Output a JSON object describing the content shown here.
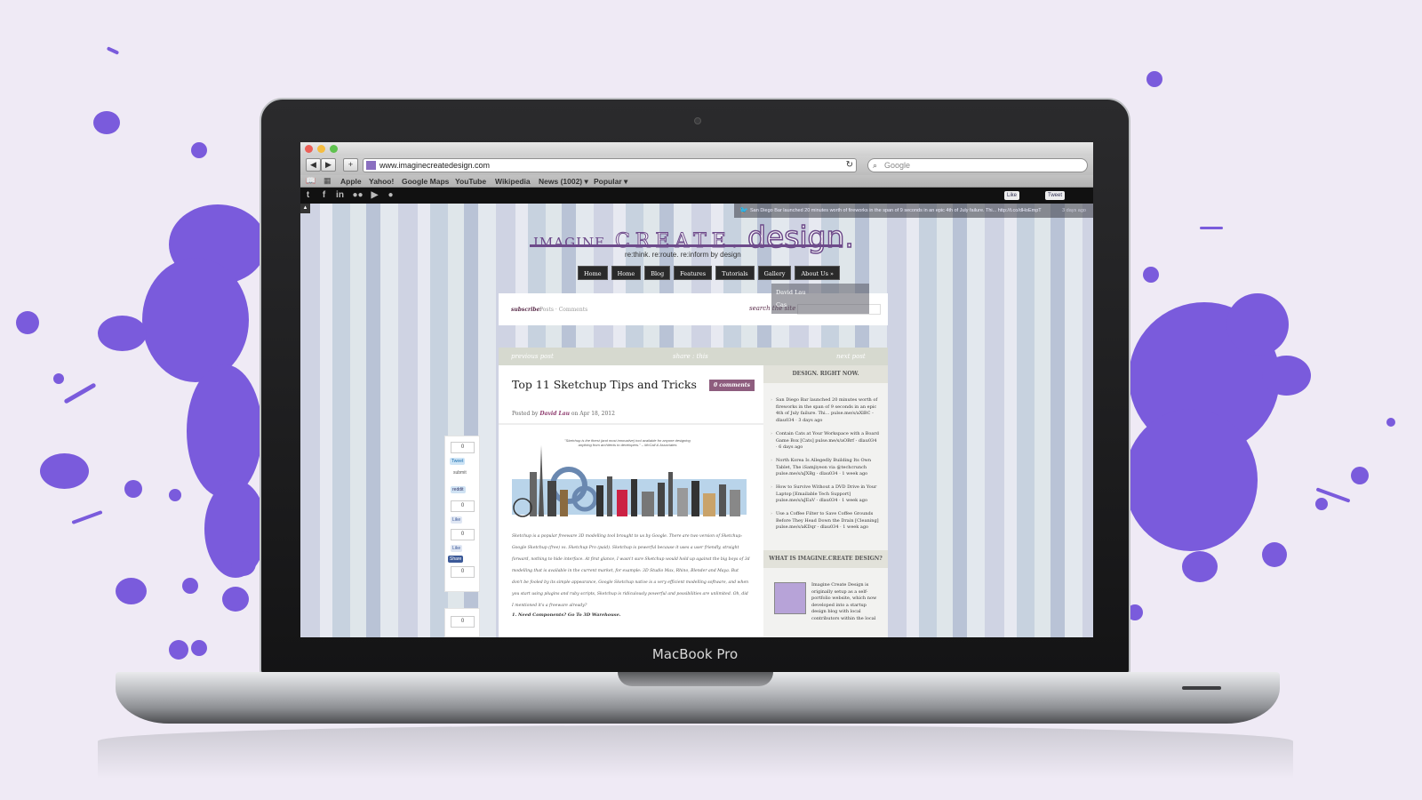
{
  "device": {
    "label": "MacBook Pro"
  },
  "browser": {
    "url": "www.imaginecreatedesign.com",
    "search_placeholder": "Google",
    "bookmarks": [
      "Apple",
      "Yahoo!",
      "Google Maps",
      "YouTube",
      "Wikipedia",
      "News (1002) ▾",
      "Popular ▾"
    ]
  },
  "social_bar": {
    "icons": [
      "twitter-icon",
      "facebook-icon",
      "linkedin-icon",
      "flickr-icon",
      "youtube-icon",
      "apple-icon"
    ],
    "like_label": "Like",
    "tweet_label": "Tweet"
  },
  "ticker": {
    "text": "San Diego Bar launched 20 minutes worth of fireworks in the span of 9 seconds in an epic 4th of July failure. Thi... http://t.co/dHoEmpT",
    "ago": "3 days ago"
  },
  "site": {
    "logo_imagine": "IMAGINE.",
    "logo_create": "CREATE.",
    "logo_design": "design.",
    "tagline": "re:think. re:route. re:inform by design",
    "menu": [
      "Home",
      "Home",
      "Blog",
      "Features",
      "Tutorials",
      "Gallery",
      "About Us »"
    ],
    "dropdown": [
      "David Lau",
      "Cas"
    ],
    "subscribe_label": "subscribe:",
    "subscribe_links": "Posts · Comments",
    "search_label": "search the site"
  },
  "post_nav": {
    "previous": "previous post",
    "share": "share : this",
    "next": "next post"
  },
  "post": {
    "title": "Top 11 Sketchup Tips and Tricks",
    "comments": "0 comments",
    "posted_prefix": "Posted by",
    "author": "David Lau",
    "date_text": "on Apr 18, 2012",
    "quote": "\"Sketchup is the finest (and most innovative) tool available for anyone designing anything from architects to developers.\" – McCall & Associates",
    "body": "Sketchup is a popular freeware 3D modelling tool brought to us by Google. There are two version of Sketchup: Google Sketchup (free) vs. Sketchup Pro (paid). Sketchup is powerful because it uses a user friendly, straight forward, nothing to hide interface. At first glance, I wasn't sure Sketchup would hold up against the big boys of 3d modelling that is available in the current market, for example: 3D Studio Max, Rhino, Blender and Maya. But don't be fooled by its simple appearance, Google Sketchup native is a very efficient modelling software, and when you start using plugins and ruby scripts, Sketchup is ridiculously powerful and possibilities are unlimited. Oh, did I mentioned it's a freeware already?",
    "list_item": "1. Need Components? Go To 3D Warehouse."
  },
  "share_rail": {
    "counts": [
      "0",
      "0",
      "0",
      "0",
      "0"
    ],
    "tweet": "Tweet",
    "submit": "submit",
    "reddit": "reddit",
    "like": "Like",
    "share": "Share"
  },
  "sidebar": {
    "head1": "DESIGN. RIGHT NOW.",
    "tweets": [
      "San Diego Bar launched 20 minutes worth of fireworks in the span of 9 seconds in an epic 4th of July failure. Thi... pulse.me/s/aXlBC - dlau034 · 3 days ago",
      "Contain Cats at Your Workspace with a Board Game Box [Cats] pulse.me/s/aOBrf - dlau034 · 6 days ago",
      "North Korea Is Allegedly Building Its Own Tablet, The iSamjiyeon via @techcrunch pulse.me/s/aJXBg - dlau034 · 1 week ago",
      "How to Survive Without a DVD Drive in Your Laptop [Emailable Tech Support] pulse.me/s/aJEaV - dlau034 · 1 week ago",
      "Use a Coffee Filter to Save Coffee Grounds Before They Head Down the Drain [Cleaning] pulse.me/s/aKDqr - dlau034 · 1 week ago"
    ],
    "head2": "WHAT IS IMAGINE.CREATE DESIGN?",
    "about": "Imagine Create Design is originally setup as a self-portfolio website, which now developed into a startup design blog with local contributors within the local"
  },
  "colors": {
    "splatter": "#7a5bdc",
    "accent": "#6d4a8a",
    "badge": "#8e5d7e"
  }
}
